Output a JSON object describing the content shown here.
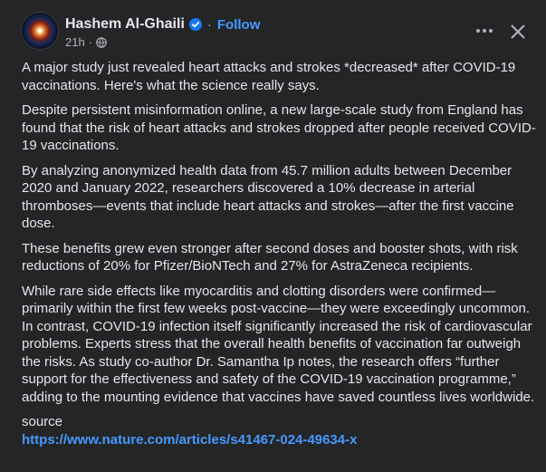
{
  "post": {
    "author": "Hashem Al-Ghaili",
    "follow_label": "Follow",
    "separator": "·",
    "time": "21h",
    "meta_separator": "·",
    "paragraphs": [
      "A major study just revealed heart attacks and strokes *decreased* after COVID-19 vaccinations. Here's what the science really says.",
      "Despite persistent misinformation online, a new large-scale study from England has found that the risk of heart attacks and strokes dropped after people received COVID-19 vaccinations.",
      "By analyzing anonymized health data from 45.7 million adults between December 2020 and January 2022, researchers discovered a 10% decrease in arterial thromboses—events that include heart attacks and strokes—after the first vaccine dose.",
      "These benefits grew even stronger after second doses and booster shots, with risk reductions of 20% for Pfizer/BioNTech and 27% for AstraZeneca recipients.",
      "While rare side effects like myocarditis and clotting disorders were confirmed—primarily within the first few weeks post-vaccine—they were exceedingly uncommon. In contrast, COVID-19 infection itself significantly increased the risk of cardiovascular problems. Experts stress that the overall health benefits of vaccination far outweigh the risks. As study co-author Dr. Samantha Ip notes, the research offers “further support for the effectiveness and safety of the COVID-19 vaccination programme,” adding to the mounting evidence that vaccines have saved countless lives worldwide."
    ],
    "source_label": "source",
    "source_url": "https://www.nature.com/articles/s41467-024-49634-x"
  },
  "icons": {
    "verified": "verified-badge-icon",
    "globe": "globe-icon",
    "more": "more-options-icon",
    "close": "close-icon"
  },
  "colors": {
    "background": "#242526",
    "text": "#e4e6eb",
    "secondary_text": "#b0b3b8",
    "link": "#4599ff",
    "verified": "#1877f2"
  }
}
